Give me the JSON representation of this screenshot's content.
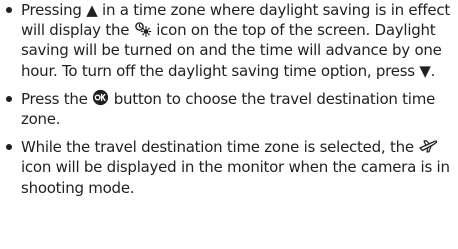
{
  "items": [
    {
      "text_before_up": "Pressing",
      "up_glyph": "▲",
      "text_before_dst_icon": "in a time zone where daylight saving is in effect will display the",
      "text_after_dst_icon": "icon on the top of the screen. Daylight saving will be turned on and the time will advance by one hour. To turn off the daylight saving time option, press",
      "down_glyph": "▼",
      "end": "."
    },
    {
      "text_before_ok": "Press the",
      "text_after_ok": "button to choose the travel destination time zone."
    },
    {
      "text_before_travel_icon": "While the travel destination time zone is selected, the",
      "text_after_travel_icon": "icon will be displayed in the monitor when the camera is in shooting mode."
    }
  ],
  "icons": {
    "up": "up-triangle-icon",
    "down": "down-triangle-icon",
    "dst": "daylight-saving-icon",
    "ok": "ok-button-icon",
    "travel": "travel-destination-icon"
  },
  "colors": {
    "text": "#231f20",
    "background": "#ffffff"
  }
}
